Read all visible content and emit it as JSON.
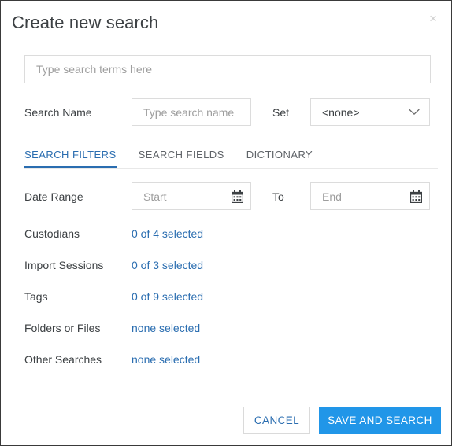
{
  "dialog": {
    "title": "Create new search",
    "close_label": "×"
  },
  "search_terms": {
    "placeholder": "Type search terms here",
    "value": ""
  },
  "search_name": {
    "label": "Search Name",
    "placeholder": "Type search name",
    "value": ""
  },
  "set": {
    "label": "Set",
    "selected": "<none>"
  },
  "tabs": [
    {
      "label": "SEARCH FILTERS",
      "active": true
    },
    {
      "label": "SEARCH FIELDS",
      "active": false
    },
    {
      "label": "DICTIONARY",
      "active": false
    }
  ],
  "date_range": {
    "label": "Date Range",
    "to_label": "To",
    "start_placeholder": "Start",
    "start_value": "",
    "end_placeholder": "End",
    "end_value": ""
  },
  "filters": [
    {
      "name": "Custodians",
      "status": "0 of 4 selected"
    },
    {
      "name": "Import Sessions",
      "status": "0 of 3 selected"
    },
    {
      "name": "Tags",
      "status": "0 of 9 selected"
    },
    {
      "name": "Folders or Files",
      "status": "none selected"
    },
    {
      "name": "Other Searches",
      "status": "none selected"
    }
  ],
  "footer": {
    "cancel_label": "CANCEL",
    "save_label": "SAVE AND SEARCH"
  },
  "colors": {
    "accent_link": "#2a6db0",
    "primary_button": "#2196e8",
    "text": "#3c4043",
    "placeholder": "#9e9e9e",
    "border": "#dcdcdc"
  }
}
